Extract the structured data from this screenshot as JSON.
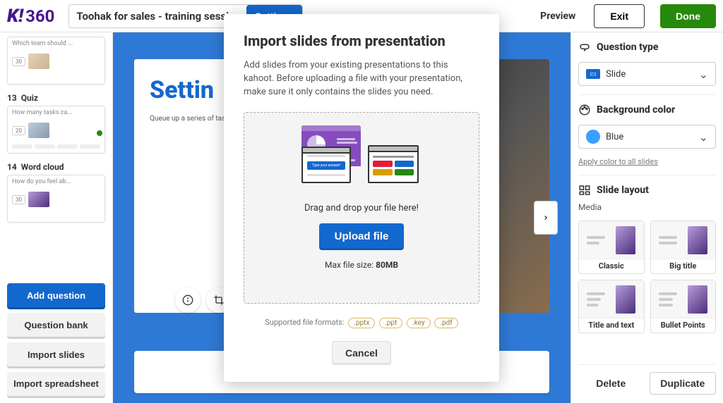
{
  "brand": {
    "k": "K!",
    "suffix": "360"
  },
  "header": {
    "title": "Toohak for sales - training session",
    "settings": "Settings",
    "preview": "Preview",
    "exit": "Exit",
    "done": "Done"
  },
  "sidebar": {
    "slides": [
      {
        "index": "",
        "name": "",
        "title": "Which team should ...",
        "badge": "30"
      },
      {
        "index": "13",
        "name": "Quiz",
        "title": "How many tasks ca...",
        "badge": "20"
      },
      {
        "index": "14",
        "name": "Word cloud",
        "title": "How do you feel ab...",
        "badge": "30"
      }
    ],
    "add_question": "Add question",
    "question_bank": "Question bank",
    "import_slides": "Import slides",
    "import_spreadsheet": "Import spreadsheet"
  },
  "canvas": {
    "headline": "Settin",
    "paragraph": "Queue up a series of\ntasks to automaticall\nand share the b"
  },
  "rightpanel": {
    "question_type": {
      "label": "Question type",
      "value": "Slide"
    },
    "bg_color": {
      "label": "Background color",
      "value": "Blue",
      "apply_link": "Apply color to all slides"
    },
    "layout": {
      "label": "Slide layout",
      "media_label": "Media",
      "cards": [
        "Classic",
        "Big title",
        "Title and text",
        "Bullet Points"
      ]
    },
    "delete": "Delete",
    "duplicate": "Duplicate"
  },
  "modal": {
    "title": "Import slides from presentation",
    "description": "Add slides from your existing presentations to this kahoot. Before uploading a file with your presentation, make sure it only contains the slides you need.",
    "drop_text": "Drag and drop your file here!",
    "upload": "Upload file",
    "max_prefix": "Max file size: ",
    "max_value": "80MB",
    "formats_label": "Supported file formats:",
    "formats": [
      ".pptx",
      ".ppt",
      ".key",
      ".pdf"
    ],
    "illus_input": "Type your answer!",
    "cancel": "Cancel"
  }
}
